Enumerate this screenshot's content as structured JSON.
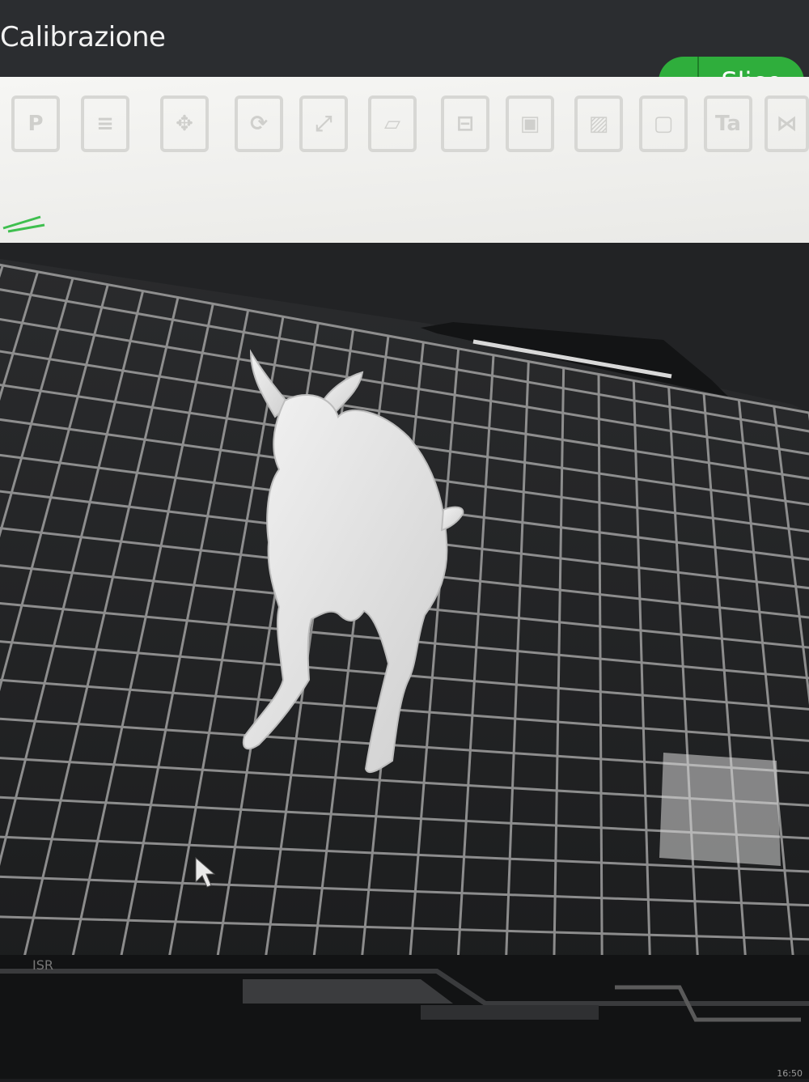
{
  "window": {
    "title": "Calibrazione"
  },
  "actions": {
    "slice_label": "Slice",
    "dropdown_glyph": "⌄"
  },
  "toolbar": {
    "tools": [
      {
        "name": "plate-icon",
        "glyph": "P"
      },
      {
        "name": "layers-icon",
        "glyph": "≡"
      },
      {
        "name": "move-icon",
        "glyph": "✥"
      },
      {
        "name": "rotate-icon",
        "glyph": "⟳"
      },
      {
        "name": "scale-icon",
        "glyph": "⤢"
      },
      {
        "name": "lay-on-face-icon",
        "glyph": "▱"
      },
      {
        "name": "cut-icon",
        "glyph": "⊟"
      },
      {
        "name": "support-icon",
        "glyph": "▣"
      },
      {
        "name": "seam-icon",
        "glyph": "▨"
      },
      {
        "name": "cube-icon",
        "glyph": "▢"
      },
      {
        "name": "text-icon",
        "glyph": "Ta"
      },
      {
        "name": "measure-icon",
        "glyph": "⋈"
      }
    ]
  },
  "status": {
    "left_text": "ISR",
    "clock": "16:50"
  },
  "colors": {
    "accent": "#2fae3c",
    "bed": "#222325",
    "grid": "#9a9a9a",
    "model": "#e6e6e6"
  }
}
